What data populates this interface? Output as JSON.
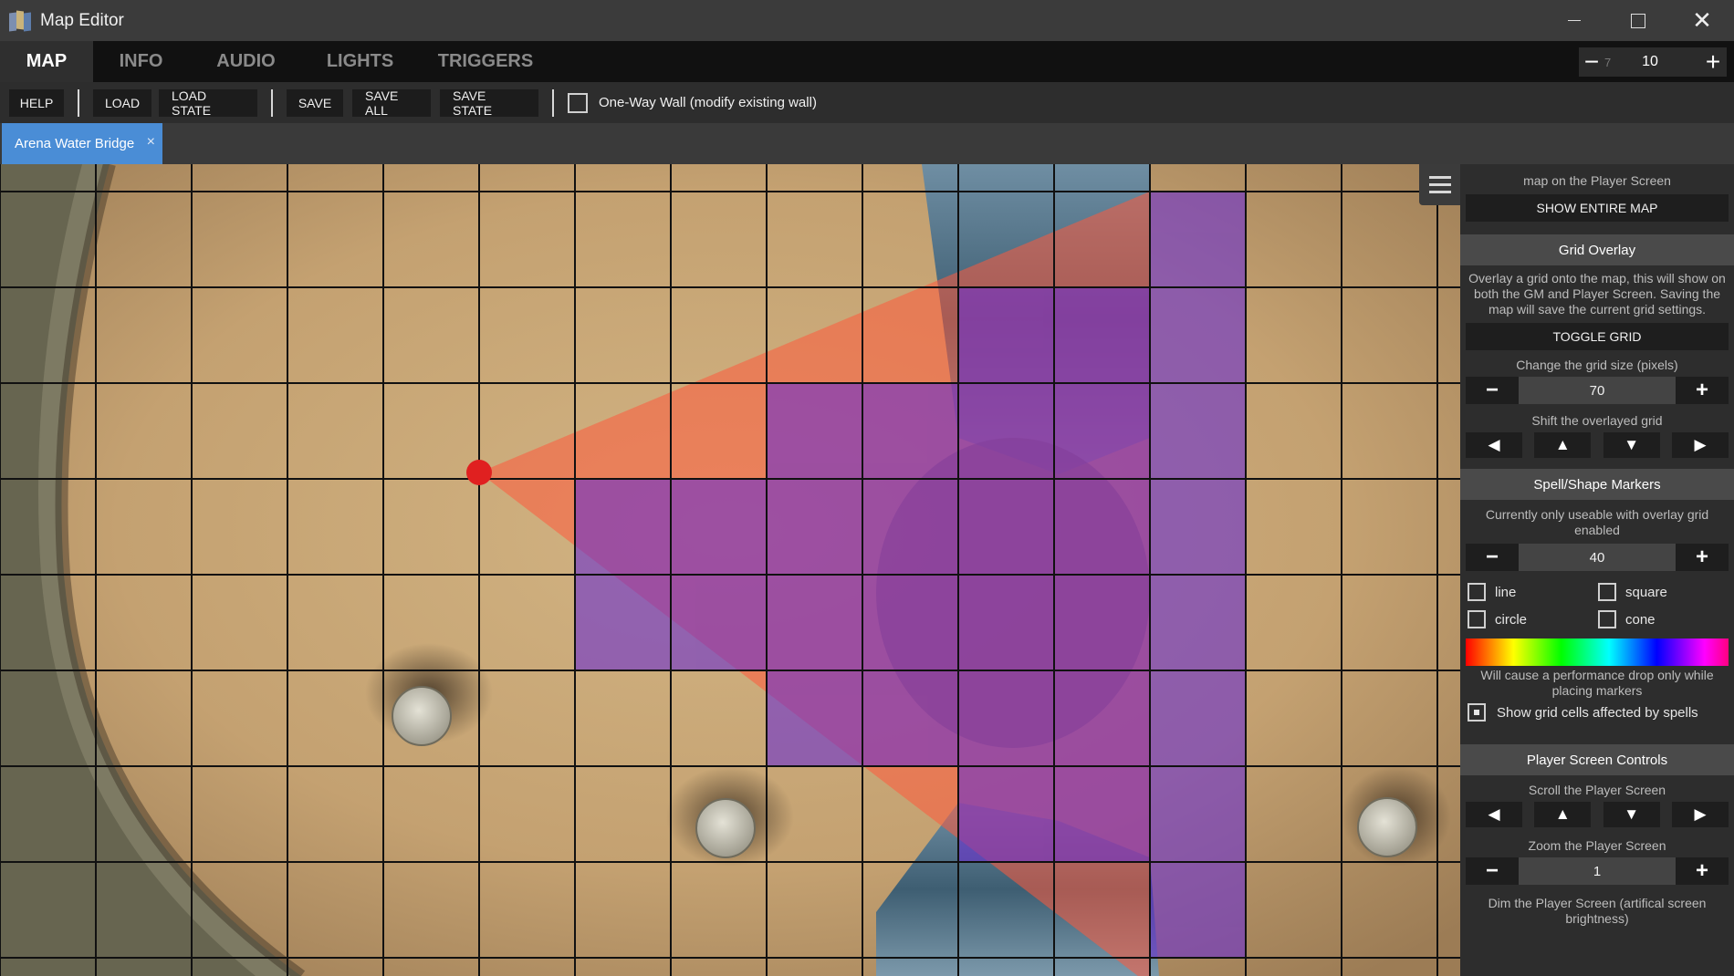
{
  "window": {
    "title": "Map Editor",
    "icon": "folded-map-icon",
    "minimize": "minimize-icon",
    "maximize": "maximize-icon",
    "close_glyph": "✕"
  },
  "menu": {
    "tabs": [
      {
        "label": "MAP",
        "active": true
      },
      {
        "label": "INFO",
        "active": false
      },
      {
        "label": "AUDIO",
        "active": false
      },
      {
        "label": "LIGHTS",
        "active": false
      },
      {
        "label": "TRIGGERS",
        "active": false
      }
    ],
    "zoom": {
      "minus": "−",
      "previous": "7",
      "value": "10",
      "plus": "+"
    }
  },
  "toolbar": {
    "help": "HELP",
    "load": "LOAD",
    "load_state": "LOAD STATE",
    "save": "SAVE",
    "save_all": "SAVE ALL",
    "save_state": "SAVE STATE",
    "one_way_wall": {
      "label": "One-Way Wall (modify existing wall)",
      "checked": false
    }
  },
  "document_tab": {
    "label": "Arena Water Bridge",
    "close": "×"
  },
  "map": {
    "grid_color": "#111111",
    "spell_fill": "#6a2fd0",
    "cone_fill": "#ff5a3c",
    "origin_marker_color": "#e02020"
  },
  "panel": {
    "top_text": "map on the Player Screen",
    "show_entire_map": "SHOW ENTIRE MAP",
    "grid_overlay": {
      "title": "Grid Overlay",
      "description": "Overlay a grid onto the map, this will show on both the GM and Player Screen. Saving the map will save the current grid settings.",
      "toggle": "TOGGLE GRID",
      "size_label": "Change the grid size (pixels)",
      "size_value": "70",
      "shift_label": "Shift the overlayed grid"
    },
    "spell_markers": {
      "title": "Spell/Shape Markers",
      "description": "Currently only useable with overlay grid enabled",
      "size_value": "40",
      "shapes": [
        {
          "label": "line",
          "checked": false
        },
        {
          "label": "square",
          "checked": false
        },
        {
          "label": "circle",
          "checked": false
        },
        {
          "label": "cone",
          "checked": false
        }
      ],
      "perf_note": "Will cause a performance drop only while placing markers",
      "show_cells": {
        "label": "Show grid cells affected by spells",
        "checked": true
      }
    },
    "player_screen": {
      "title": "Player Screen Controls",
      "scroll_label": "Scroll the Player Screen",
      "zoom_label": "Zoom the Player Screen",
      "zoom_value": "1",
      "dim_label": "Dim the Player Screen (artifical screen brightness)"
    },
    "glyphs": {
      "minus": "−",
      "plus": "+",
      "left": "◀",
      "up": "▲",
      "down": "▼",
      "right": "▶"
    }
  }
}
